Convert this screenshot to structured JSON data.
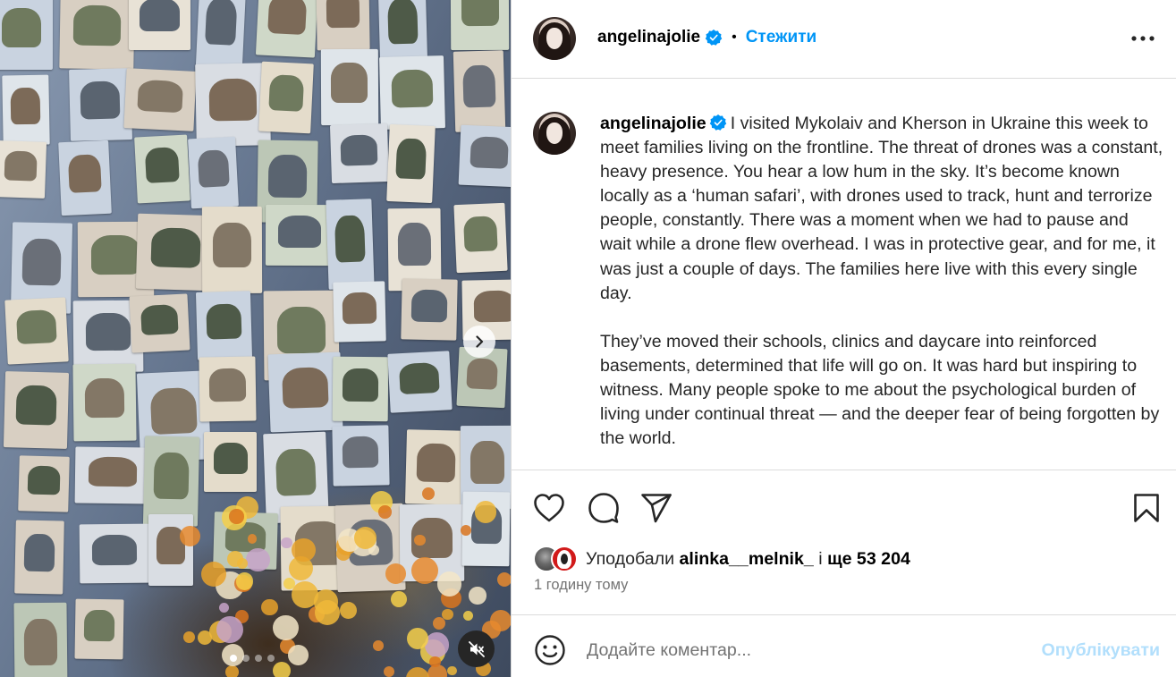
{
  "post": {
    "author": "angelinajolie",
    "follow_label": "Стежити",
    "separator": "•",
    "caption_paragraphs": [
      "I visited Mykolaiv and Kherson in Ukraine this week to meet families living on the frontline. The threat of drones was a constant, heavy presence. You hear a low hum in the sky. It’s become known locally as a ‘human safari’, with drones used to track, hunt and terrorize people, constantly. There was a moment when we had to pause and wait while a drone flew overhead. I was in protective gear, and for me, it was just a couple of days. The families here live with this every single day.",
      "They’ve moved their schools, clinics and daycare into reinforced basements, determined that life will go on. It was hard but inspiring to witness. Many people spoke to me about the psychological burden of living under continual threat — and the deeper fear of being forgotten by the world."
    ]
  },
  "likes": {
    "prefix": "Уподобали",
    "user": "alinka__melnik_",
    "middle": "і",
    "count": "ще 53 204"
  },
  "timestamp": "1 годину тому",
  "comment": {
    "placeholder": "Додайте коментар...",
    "publish_label": "Опублікувати"
  },
  "carousel": {
    "slide_count": 4,
    "active_slide": 1
  },
  "icons": {
    "verified": "verified-badge-icon",
    "more": "more-options-icon",
    "next": "chevron-right-icon",
    "mute": "speaker-muted-icon",
    "like": "heart-icon",
    "comment": "comment-bubble-icon",
    "share": "send-icon",
    "save": "bookmark-icon",
    "emoji": "emoji-icon"
  },
  "colors": {
    "accent": "#0095f6",
    "verified": "#0095f6",
    "publish_disabled": "#b2dffc",
    "secondary_text": "#737373",
    "border": "#dbdbdb"
  }
}
